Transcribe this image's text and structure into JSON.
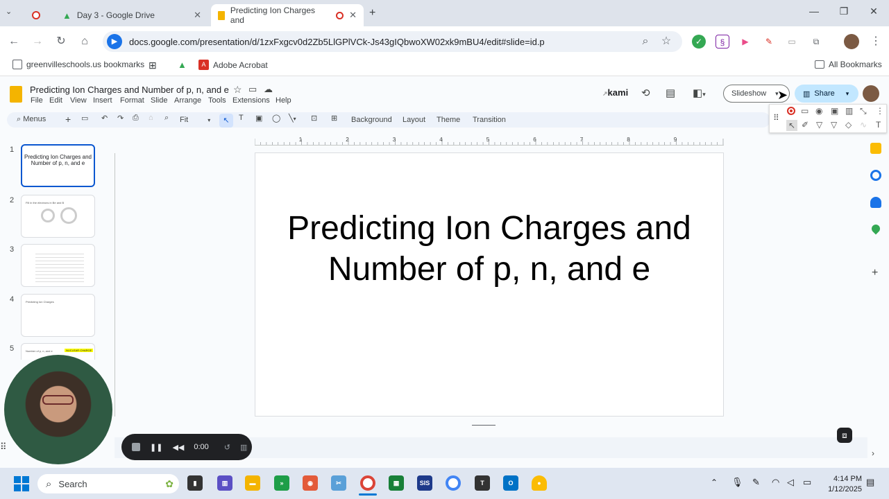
{
  "browser": {
    "tabs": [
      {
        "label": ""
      },
      {
        "label": "Day 3 - Google Drive"
      },
      {
        "label": "Predicting Ion Charges and"
      }
    ],
    "url": "docs.google.com/presentation/d/1zxFxgcv0d2Zb5LlGPlVCk-Js43gIQbwoXW02xk9mBU4/edit#slide=id.p",
    "bookmarks": [
      "greenvilleschools.us bookmarks",
      "Adobe Acrobat"
    ],
    "all_bookmarks": "All Bookmarks"
  },
  "slides": {
    "doc_title": "Predicting Ion Charges and Number of p, n, and e",
    "menus": [
      "File",
      "Edit",
      "View",
      "Insert",
      "Format",
      "Slide",
      "Arrange",
      "Tools",
      "Extensions",
      "Help"
    ],
    "kami_label": "kami",
    "slideshow_label": "Slideshow",
    "share_label": "Share",
    "toolbar": {
      "menus": "Menus",
      "zoom": "Fit",
      "background": "Background",
      "layout": "Layout",
      "theme": "Theme",
      "transition": "Transition"
    },
    "ruler_numbers": [
      "1",
      "2",
      "3",
      "4",
      "5",
      "6",
      "7",
      "8",
      "9"
    ],
    "thumbnails": [
      {
        "num": "1",
        "title": "Predicting Ion Charges and Number of p, n, and e"
      },
      {
        "num": "2",
        "title": "Fill in the electrons in Be and B"
      },
      {
        "num": "3",
        "title": ""
      },
      {
        "num": "4",
        "title": "Predicting Ion Charges"
      },
      {
        "num": "5",
        "title": "Number of p, n, and e"
      }
    ],
    "thumb5_badge": "NUCLEAR CHARGE",
    "slide_title": "Predicting Ion Charges and Number of p, n, and e"
  },
  "recorder": {
    "time": "0:00"
  },
  "taskbar": {
    "search": "Search",
    "time": "4:14 PM",
    "date": "1/12/2025",
    "sis": "SIS"
  }
}
